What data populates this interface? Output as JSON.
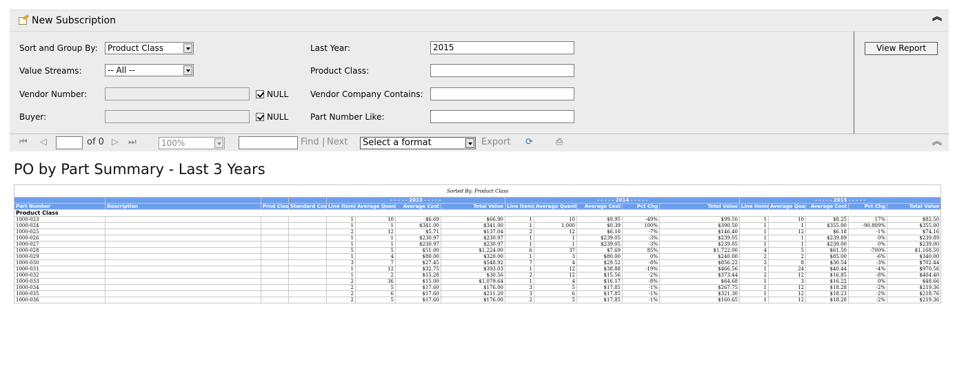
{
  "subscription": {
    "label": "New Subscription"
  },
  "params": {
    "sort_label": "Sort and Group By:",
    "sort_value": "Product Class",
    "vs_label": "Value Streams:",
    "vs_value": "-- All --",
    "vendor_label": "Vendor Number:",
    "vendor_value": "",
    "buyer_label": "Buyer:",
    "buyer_value": "",
    "null_label": "NULL",
    "last_year_label": "Last Year:",
    "last_year_value": "2015",
    "product_class_label": "Product Class:",
    "product_class_value": "",
    "vendor_company_label": "Vendor Company Contains:",
    "vendor_company_value": "",
    "part_like_label": "Part Number Like:",
    "part_like_value": "",
    "view_report": "View Report"
  },
  "toolbar": {
    "page_value": "",
    "of_label": "of 0",
    "zoom": "100%",
    "find_value": "",
    "find": "Find",
    "sep": "|",
    "next": "Next",
    "format": "Select a format",
    "export": "Export"
  },
  "report": {
    "title": "PO by Part Summary - Last 3 Years",
    "sorted_by": "Sorted By: Product Class",
    "headers": {
      "part_number": "Part Number",
      "description": "Description",
      "prod_class": "Prod Class",
      "standard_cost": "Standard Cost",
      "y2013": "- - - - - 2013 - - - - -",
      "y2014": "- - - - - 2014 - - - - -",
      "y2015": "- - - - - 2015 - - - - -",
      "line_items": "Line Items",
      "avg_qty": "Average Quantity",
      "avg_cost": "Average Cost",
      "total_value": "Total Value",
      "pct_chg": "Pct Chg"
    },
    "group_label": "Product Class",
    "rows": [
      [
        "1000-023",
        "1",
        "10",
        "$6.69",
        "$66.90",
        "1",
        "10",
        "$9.95",
        "-49%",
        "$99.50",
        "1",
        "10",
        "$8.25",
        "17%",
        "$82.50"
      ],
      [
        "1000-024",
        "1",
        "1",
        "$341.00",
        "$341.00",
        "1",
        "1,000",
        "$0.39",
        "100%",
        "$390.50",
        "1",
        "1",
        "$355.00",
        "-90,809%",
        "$355.00"
      ],
      [
        "1000-025",
        "2",
        "12",
        "$5.71",
        "$137.04",
        "2",
        "12",
        "$6.10",
        "-7%",
        "$146.40",
        "1",
        "12",
        "$6.18",
        "-1%",
        "$74.16"
      ],
      [
        "1000-026",
        "1",
        "1",
        "$230.97",
        "$230.97",
        "1",
        "1",
        "$239.05",
        "-3%",
        "$239.05",
        "1",
        "1",
        "$239.89",
        "0%",
        "$239.89"
      ],
      [
        "1000-027",
        "1",
        "1",
        "$230.97",
        "$230.97",
        "1",
        "1",
        "$239.05",
        "-3%",
        "$239.05",
        "1",
        "1",
        "$239.00",
        "0%",
        "$239.00"
      ],
      [
        "1000-028",
        "5",
        "5",
        "$51.00",
        "$1,224.00",
        "6",
        "37",
        "$7.69",
        "85%",
        "$1,722.00",
        "4",
        "5",
        "$61.50",
        "-700%",
        "$1,168.50"
      ],
      [
        "1000-029",
        "1",
        "4",
        "$80.00",
        "$320.00",
        "1",
        "3",
        "$80.00",
        "0%",
        "$240.00",
        "2",
        "2",
        "$85.00",
        "-6%",
        "$340.00"
      ],
      [
        "1000-030",
        "3",
        "7",
        "$27.45",
        "$548.92",
        "7",
        "4",
        "$29.52",
        "-8%",
        "$856.22",
        "3",
        "8",
        "$30.54",
        "-3%",
        "$702.44"
      ],
      [
        "1000-031",
        "1",
        "12",
        "$32.75",
        "$393.03",
        "1",
        "12",
        "$38.88",
        "-19%",
        "$466.56",
        "1",
        "24",
        "$40.44",
        "-4%",
        "$970.56"
      ],
      [
        "1000-032",
        "1",
        "2",
        "$15.28",
        "$30.56",
        "2",
        "12",
        "$15.56",
        "-2%",
        "$373.44",
        "2",
        "12",
        "$16.85",
        "-8%",
        "$404.40"
      ],
      [
        "1000-033",
        "2",
        "36",
        "$15.00",
        "$1,079.64",
        "1",
        "4",
        "$16.17",
        "-8%",
        "$64.68",
        "1",
        "3",
        "$16.22",
        "0%",
        "$48.66"
      ],
      [
        "1000-034",
        "2",
        "5",
        "$17.60",
        "$176.00",
        "3",
        "5",
        "$17.85",
        "-1%",
        "$267.75",
        "1",
        "12",
        "$18.28",
        "-2%",
        "$219.36"
      ],
      [
        "1000-035",
        "2",
        "6",
        "$17.60",
        "$211.20",
        "3",
        "6",
        "$17.85",
        "-1%",
        "$321.30",
        "1",
        "12",
        "$18.23",
        "-2%",
        "$218.76"
      ],
      [
        "1000-036",
        "2",
        "5",
        "$17.60",
        "$176.00",
        "2",
        "5",
        "$17.85",
        "-1%",
        "$160.65",
        "1",
        "12",
        "$18.28",
        "-2%",
        "$219.36"
      ]
    ]
  }
}
